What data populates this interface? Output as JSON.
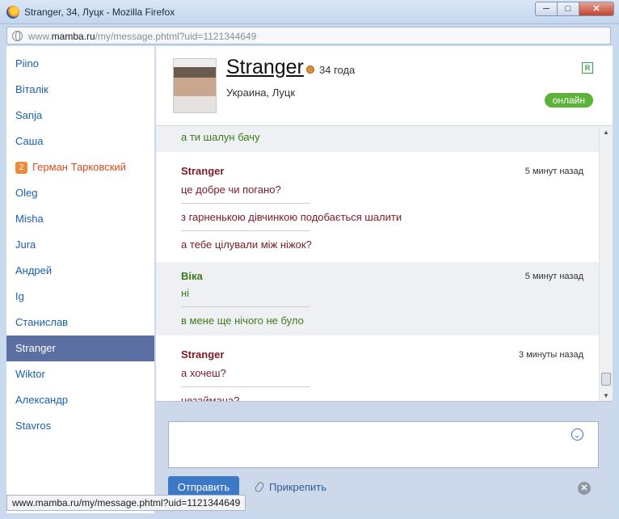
{
  "window": {
    "title": "Stranger, 34, Луцк - Mozilla Firefox",
    "min": "─",
    "max": "□",
    "close": "✕"
  },
  "url": {
    "prefix": "www.",
    "domain": "mamba.ru",
    "path": "/my/message.phtml?uid=1121344649"
  },
  "contacts": [
    {
      "label": "Piino"
    },
    {
      "label": "Віталік"
    },
    {
      "label": "Sanja"
    },
    {
      "label": "Саша"
    },
    {
      "label": "Герман Тарковский",
      "badge": "2"
    },
    {
      "label": "Oleg"
    },
    {
      "label": "Misha"
    },
    {
      "label": "Jura"
    },
    {
      "label": "Андрей"
    },
    {
      "label": "Ig"
    },
    {
      "label": "Станислав"
    },
    {
      "label": "Stranger",
      "active": true
    },
    {
      "label": "Wiktor"
    },
    {
      "label": "Александр"
    },
    {
      "label": "Stavros"
    }
  ],
  "profile": {
    "name": "Stranger",
    "age": "34 года",
    "location": "Украина, Луцк",
    "real_badge": "R",
    "status": "онлайн"
  },
  "messages": {
    "top_line": "а ти шалун бачу",
    "block1": {
      "author": "Stranger",
      "time": "5 минут назад",
      "lines": [
        "це добре чи погано?",
        "з гарненькою дівчинкою подобається шалити",
        "а тебе цілували між ніжок?"
      ]
    },
    "block2": {
      "author": "Віка",
      "time": "5 минут назад",
      "lines": [
        "ні",
        "в мене ще нічого не було"
      ]
    },
    "block3": {
      "author": "Stranger",
      "time": "3 минуты назад",
      "lines": [
        "а хочеш?",
        "незаймана?"
      ]
    }
  },
  "compose": {
    "send_label": "Отправить",
    "attach_label": "Прикрепить"
  },
  "status_url": "www.mamba.ru/my/message.phtml?uid=1121344649",
  "colors": {
    "accent": "#3c78c6",
    "active_item": "#5c6fa3",
    "online": "#5cb338"
  }
}
